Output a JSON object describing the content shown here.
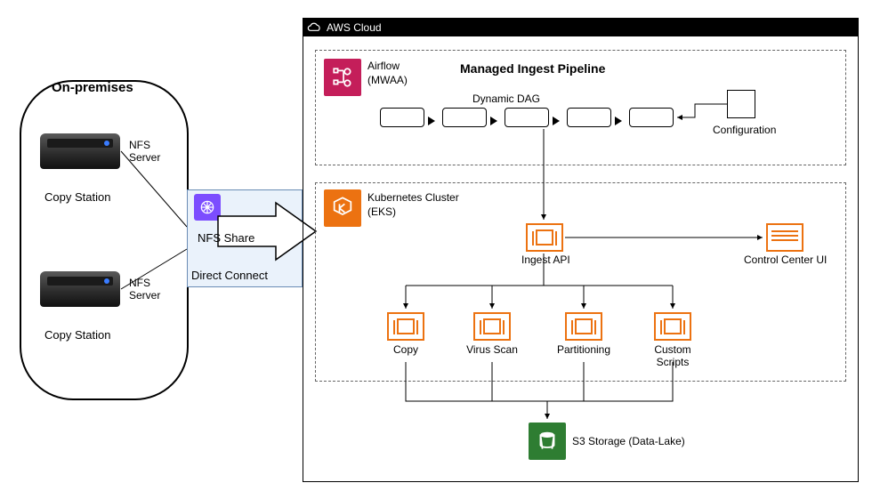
{
  "onprem": {
    "title": "On-premises",
    "nfs_label": "NFS Server",
    "copy_station": "Copy Station"
  },
  "direct_connect": {
    "nfs_share": "NFS Share",
    "label": "Direct Connect"
  },
  "aws": {
    "title": "AWS Cloud",
    "pipeline": {
      "airflow": "Airflow (MWAA)",
      "title": "Managed Ingest Pipeline",
      "dag_label": "Dynamic DAG",
      "config": "Configuration"
    },
    "eks": {
      "label": "Kubernetes Cluster (EKS)",
      "ingest_api": "Ingest API",
      "control_center": "Control Center UI",
      "services": {
        "copy": "Copy",
        "virus": "Virus Scan",
        "partition": "Partitioning",
        "custom": "Custom Scripts"
      }
    },
    "s3": "S3 Storage (Data-Lake)"
  }
}
